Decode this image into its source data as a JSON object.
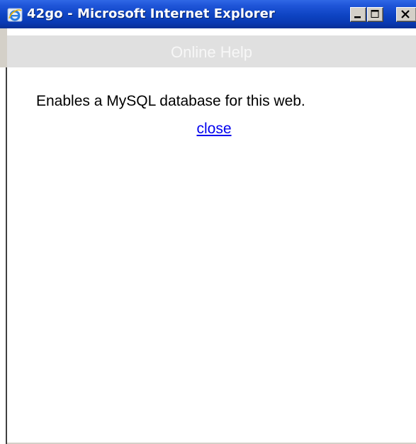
{
  "window": {
    "title": "42go - Microsoft Internet Explorer",
    "icons": {
      "app": "internet-explorer-icon",
      "minimize": "minimize-icon",
      "maximize": "maximize-icon",
      "close": "close-icon"
    }
  },
  "page": {
    "header_title": "Online Help",
    "help_text": "Enables a MySQL database for this web.",
    "close_link": "close"
  },
  "colors": {
    "titlebar": "#0d43c2",
    "header_band": "#e0e0e0",
    "link": "#0000ee"
  }
}
